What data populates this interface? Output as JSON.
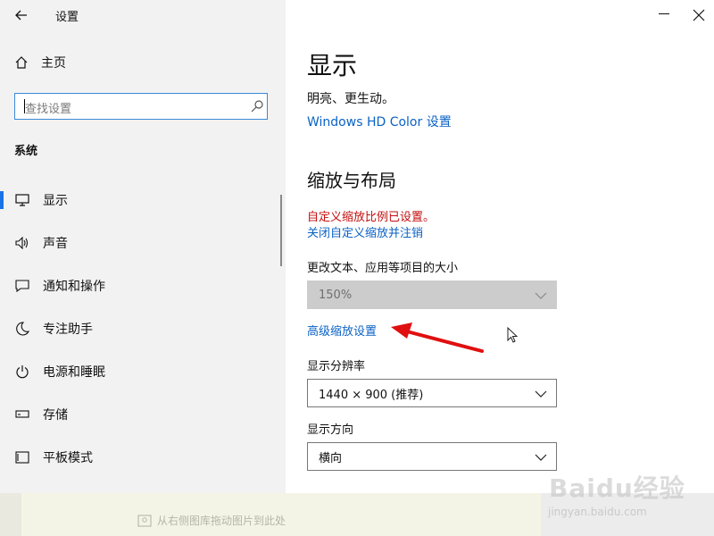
{
  "window": {
    "title": "设置"
  },
  "sidebar": {
    "home_label": "主页",
    "search_placeholder": "查找设置",
    "section": "系统",
    "items": [
      {
        "label": "显示",
        "icon": "monitor-icon",
        "active": true
      },
      {
        "label": "声音",
        "icon": "speaker-icon"
      },
      {
        "label": "通知和操作",
        "icon": "message-icon"
      },
      {
        "label": "专注助手",
        "icon": "moon-icon"
      },
      {
        "label": "电源和睡眠",
        "icon": "power-icon"
      },
      {
        "label": "存储",
        "icon": "storage-icon"
      },
      {
        "label": "平板模式",
        "icon": "tablet-icon"
      }
    ]
  },
  "main": {
    "page_title": "显示",
    "desc_tail": "明亮、更生动。",
    "hdr_link": "Windows HD Color 设置",
    "section_title": "缩放与布局",
    "custom_scale_warning": "自定义缩放比例已设置。",
    "turn_off_custom_link": "关闭自定义缩放并注销",
    "size_label": "更改文本、应用等项目的大小",
    "size_value": "150%",
    "advanced_scaling_link": "高级缩放设置",
    "resolution_label": "显示分辨率",
    "resolution_value": "1440 × 900 (推荐)",
    "orientation_label": "显示方向",
    "orientation_value": "横向"
  },
  "footer": {
    "drop_text": "从右侧图库拖动图片到此处"
  },
  "watermark": {
    "brand": "Baidu经验",
    "url": "jingyan.baidu.com"
  },
  "colors": {
    "accent": "#0b62c4",
    "warning": "#c50e0e",
    "arrow": "#e01010"
  }
}
